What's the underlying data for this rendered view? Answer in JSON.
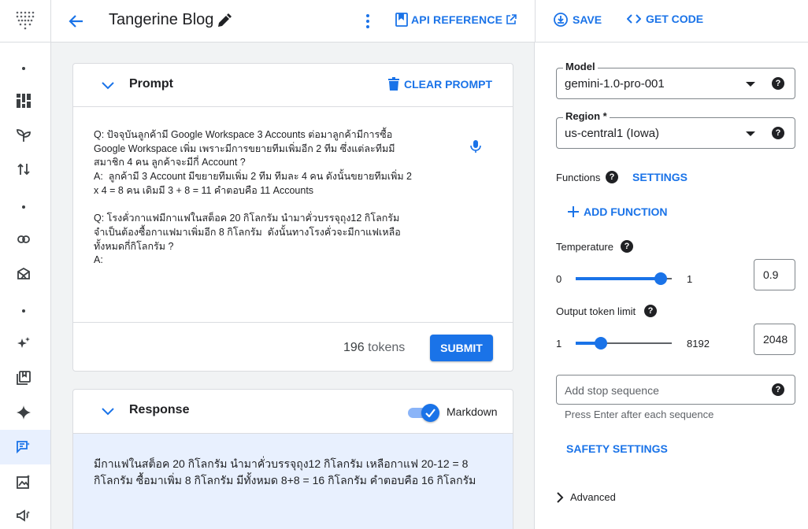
{
  "header": {
    "title": "Tangerine Blog",
    "api_reference": "API REFERENCE",
    "save": "SAVE",
    "get_code": "GET CODE"
  },
  "rail": {
    "icons": [
      "logo-icon",
      "dashboard-icon",
      "sprout-icon",
      "swap-icon",
      "link-icon",
      "model-garden-icon",
      "sparkle-icon",
      "book-icon",
      "gemini-icon",
      "chat-prompt-icon",
      "image-icon",
      "announce-icon"
    ],
    "active": "chat-prompt-icon"
  },
  "prompt": {
    "title": "Prompt",
    "clear": "CLEAR PROMPT",
    "text": "Q: ปัจจุบันลูกค้ามี Google Workspace 3 Accounts ต่อมาลูกค้ามีการซื้อ\nGoogle Workspace เพิ่ม เพราะมีการขยายทีมเพิ่มอีก 2 ทีม ซึ่งแต่ละทีมมี\nสมาชิก 4 คน ลูกค้าจะมีกี่ Account ?\nA:  ลูกค้ามี 3 Account มีขยายทีมเพิ่ม 2 ทีม ทีมละ 4 คน ดังนั้นขยายทีมเพิ่ม 2\nx 4 = 8 คน เดิมมี 3 + 8 = 11 คำตอบคือ 11 Accounts\n\nQ: โรงคั่วกาแฟมีกาแฟในสต็อค 20 กิโลกรัม นำมาคั่วบรรจุถุง12 กิโลกรัม\nจำเป็นต้องซื้อกาแฟมาเพิ่มอีก 8 กิโลกรัม  ดังนั้นทางโรงคั่วจะมีกาแฟเหลือ\nทั้งหมดกี่กิโลกรัม ?\nA:",
    "token_count": "196",
    "token_unit": "tokens",
    "submit": "SUBMIT"
  },
  "response": {
    "title": "Response",
    "markdown_label": "Markdown",
    "markdown_enabled": true,
    "text": "มีกาแฟในสต็อค 20 กิโลกรัม นำมาคั่วบรรจุถุง12 กิโลกรัม เหลือกาแฟ 20-12 = 8 กิโลกรัม ซื้อมาเพิ่ม 8 กิโลกรัม มีทั้งหมด 8+8 = 16 กิโลกรัม คำตอบคือ 16 กิโลกรัม"
  },
  "panel": {
    "model_label": "Model",
    "model_value": "gemini-1.0-pro-001",
    "region_label": "Region *",
    "region_value": "us-central1 (Iowa)",
    "functions_label": "Functions",
    "settings": "SETTINGS",
    "add_function": "ADD FUNCTION",
    "temperature_label": "Temperature",
    "temperature_min": "0",
    "temperature_max": "1",
    "temperature_value": "0.9",
    "output_label": "Output token limit",
    "output_min": "1",
    "output_max": "8192",
    "output_value": "2048",
    "stop_placeholder": "Add stop sequence",
    "stop_hint": "Press Enter after each sequence",
    "safety": "SAFETY SETTINGS",
    "advanced": "Advanced"
  },
  "colors": {
    "accent": "#1a73e8",
    "response_bg": "#e8f0fe",
    "canvas_bg": "#f1f3f4"
  }
}
